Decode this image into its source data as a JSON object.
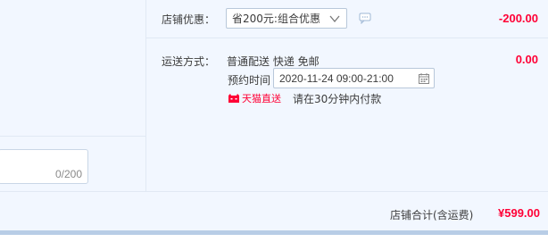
{
  "store_discount": {
    "label": "店铺优惠：",
    "selected": "省200元:组合优惠",
    "amount": "-200.00"
  },
  "shipping": {
    "label": "运送方式：",
    "method": "普通配送 快递 免邮",
    "amount": "0.00",
    "appointment_label": "预约时间",
    "appointment_value": "2020-11-24 09:00-21:00",
    "tmall_brand": "天猫直送",
    "payment_note": "请在30分钟内付款"
  },
  "message": {
    "counter": "0/200"
  },
  "summary": {
    "label": "店铺合计(含运费)",
    "total": "¥599.00"
  },
  "colors": {
    "accent": "#ff0036",
    "panel_bg": "#f2f7ff",
    "border": "#b8c8da"
  }
}
